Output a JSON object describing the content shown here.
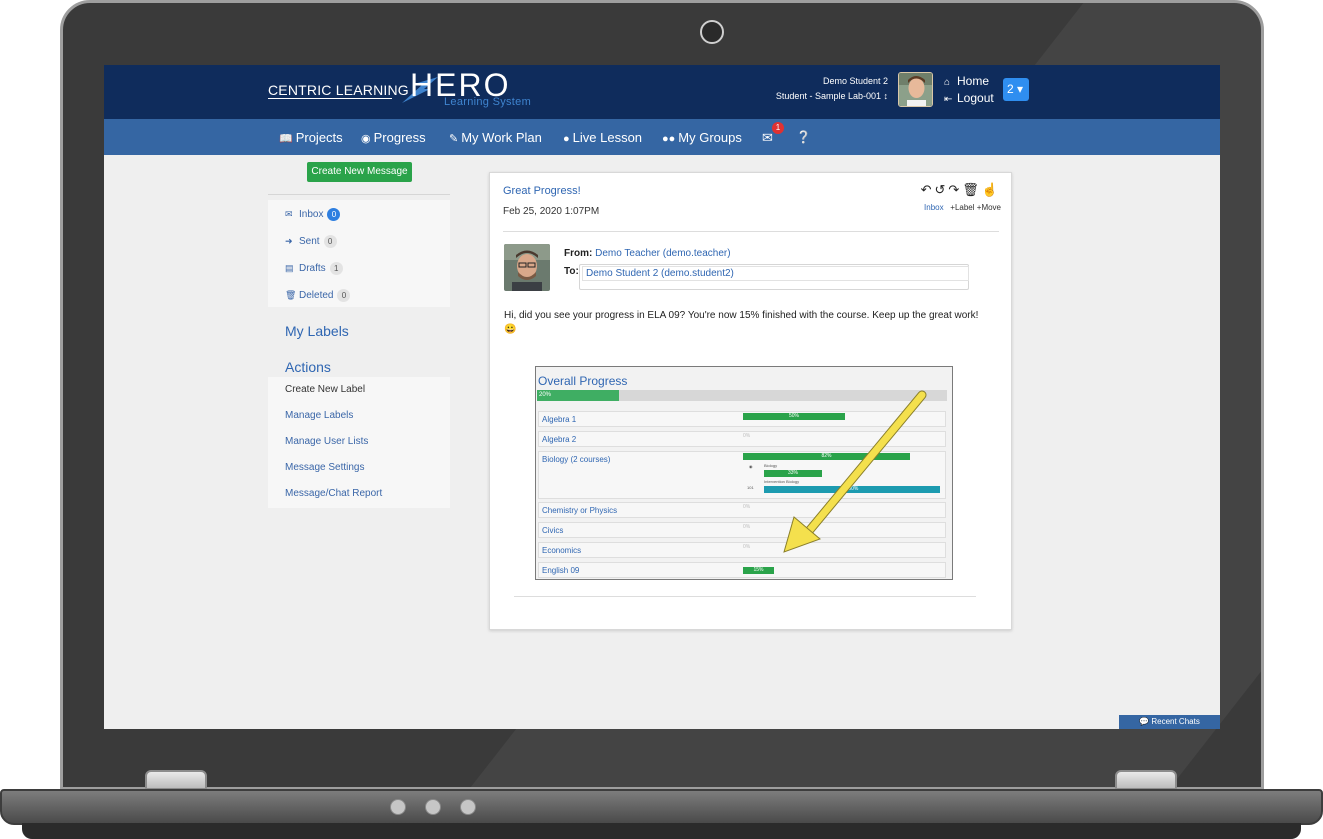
{
  "header": {
    "brand_left": "CENTRIC LEARNING",
    "brand_main": "HERO",
    "brand_sub": "Learning System",
    "user_name": "Demo Student 2",
    "user_role": "Student - Sample Lab-001 ↕",
    "home_label": "Home",
    "logout_label": "Logout",
    "account_badge": "2 ▾"
  },
  "menu": {
    "items": [
      {
        "icon": "book-icon",
        "label": "Projects"
      },
      {
        "icon": "dashboard-icon",
        "label": "Progress"
      },
      {
        "icon": "pencil-icon",
        "label": "My Work Plan"
      },
      {
        "icon": "microphone-icon",
        "label": "Live Lesson"
      },
      {
        "icon": "users-icon",
        "label": "My Groups"
      }
    ],
    "mail_count": "1",
    "help_icon": "question-circle-icon"
  },
  "sidebar": {
    "create_button": "Create New Message",
    "folders": [
      {
        "icon": "envelope-icon",
        "label": "Inbox",
        "count": "0"
      },
      {
        "icon": "arrow-circle-right-icon",
        "label": "Sent",
        "count": "0"
      },
      {
        "icon": "drafts-icon",
        "label": "Drafts",
        "count": "1"
      },
      {
        "icon": "trash-icon",
        "label": "Deleted",
        "count": "0"
      }
    ],
    "my_labels_title": "My Labels",
    "actions_title": "Actions",
    "actions": [
      "Create New Label",
      "Manage Labels",
      "Manage User Lists",
      "Message Settings",
      "Message/Chat Report"
    ]
  },
  "message": {
    "subject": "Great Progress!",
    "date": "Feb 25, 2020 1:07PM",
    "from_label": "From:",
    "from_value": "Demo Teacher (demo.teacher)",
    "to_label": "To:",
    "to_value": "Demo Student 2 (demo.student2)",
    "body": "Hi, did you see your progress in ELA 09? You're now 15% finished with the course. Keep up the great work!",
    "emoji": "😀",
    "folder_link": "Inbox",
    "label_link": "+Label",
    "move_link": "+Move"
  },
  "progress_shot": {
    "title": "Overall Progress",
    "overall_label": "20%",
    "overall_value": 0.2,
    "courses": [
      {
        "name": "Algebra 1",
        "label": "50%",
        "value": 0.5
      },
      {
        "name": "Algebra 2",
        "label": "0%",
        "value": 0
      },
      {
        "name": "Biology (2 courses)",
        "label": "82%",
        "value": 0.82
      },
      {
        "name": "Chemistry or Physics",
        "label": "0%",
        "value": 0
      },
      {
        "name": "Civics",
        "label": "0%",
        "value": 0
      },
      {
        "name": "Economics",
        "label": "0%",
        "value": 0
      },
      {
        "name": "English 09",
        "label": "15%",
        "value": 0.15
      }
    ],
    "biology_sub": [
      {
        "name": "Biology",
        "label": "33%",
        "value": 0.33
      },
      {
        "name": "Intervention Biology",
        "label": "100%",
        "value": 1.0
      }
    ]
  },
  "chat": {
    "recent_chats": "Recent Chats"
  },
  "colors": {
    "topbar": "#0f2c5c",
    "menubar": "#3566a3",
    "green": "#2aa34a",
    "teal": "#1d9bb0",
    "arrow": "#f4e04d"
  }
}
